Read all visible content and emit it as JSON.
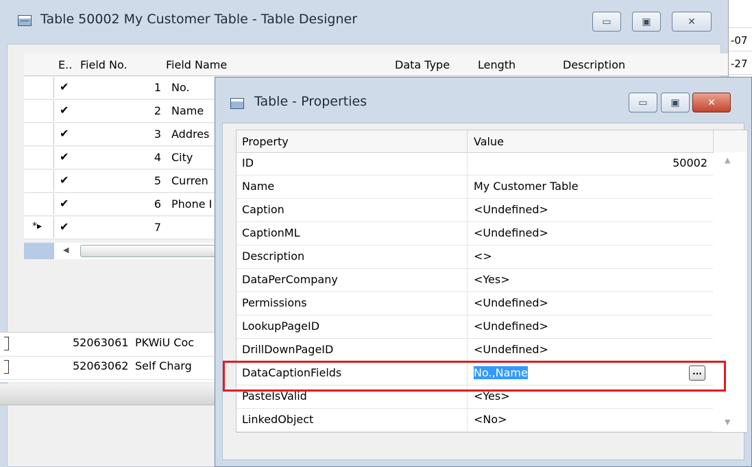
{
  "designer": {
    "title": "Table 50002 My Customer Table - Table Designer",
    "columns": [
      "E..",
      "Field No.",
      "Field Name",
      "Data Type",
      "Length",
      "Description"
    ],
    "rows": [
      {
        "enabled": "✔",
        "no": "1",
        "name": "No."
      },
      {
        "enabled": "✔",
        "no": "2",
        "name": "Name"
      },
      {
        "enabled": "✔",
        "no": "3",
        "name": "Addres"
      },
      {
        "enabled": "✔",
        "no": "4",
        "name": "City"
      },
      {
        "enabled": "✔",
        "no": "5",
        "name": "Curren"
      },
      {
        "enabled": "✔",
        "no": "6",
        "name": "Phone I"
      },
      {
        "enabled": "✔",
        "no": "7",
        "name": "",
        "marker": "*▸"
      }
    ]
  },
  "background_rows": [
    {
      "code": "52063061",
      "text": "PKWiU Coc"
    },
    {
      "code": "52063062",
      "text": "Self Charg"
    }
  ],
  "right_strip": [
    "-07",
    "-27"
  ],
  "properties": {
    "title": "Table - Properties",
    "header_property": "Property",
    "header_value": "Value",
    "rows": [
      {
        "name": "ID",
        "value": "50002"
      },
      {
        "name": "Name",
        "value": "My Customer Table"
      },
      {
        "name": "Caption",
        "value": "<Undefined>"
      },
      {
        "name": "CaptionML",
        "value": "<Undefined>"
      },
      {
        "name": "Description",
        "value": "<>"
      },
      {
        "name": "DataPerCompany",
        "value": "<Yes>"
      },
      {
        "name": "Permissions",
        "value": "<Undefined>"
      },
      {
        "name": "LookupPageID",
        "value": "<Undefined>"
      },
      {
        "name": "DrillDownPageID",
        "value": "<Undefined>"
      },
      {
        "name": "DataCaptionFields",
        "value": "No.,Name"
      },
      {
        "name": "PasteIsValid",
        "value": "<Yes>"
      },
      {
        "name": "LinkedObject",
        "value": "<No>"
      }
    ],
    "ellipsis_label": "...",
    "highlight_color": "#e01b22"
  },
  "caption_buttons": {
    "minimize": "▭",
    "maximize": "▣",
    "close": "✕"
  }
}
